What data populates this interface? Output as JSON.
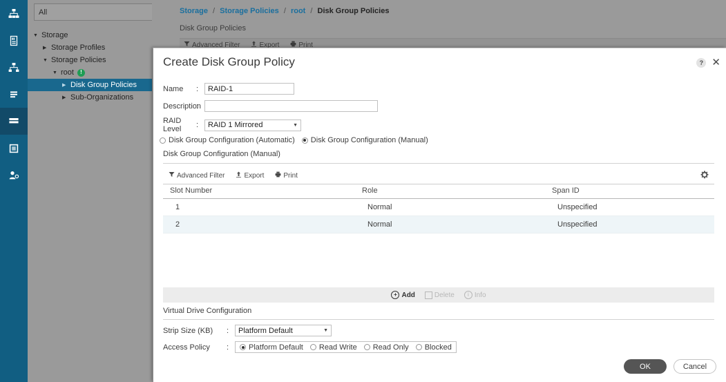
{
  "nav_rail": {
    "items": [
      {
        "name": "equipment-icon",
        "selected": false
      },
      {
        "name": "servers-icon",
        "selected": false
      },
      {
        "name": "lan-icon",
        "selected": false
      },
      {
        "name": "san-icon",
        "selected": false
      },
      {
        "name": "storage-icon",
        "selected": true
      },
      {
        "name": "chassis-icon",
        "selected": false
      },
      {
        "name": "admin-icon",
        "selected": false
      }
    ]
  },
  "sidebar": {
    "scope_value": "All",
    "tree": [
      {
        "label": "Storage",
        "level": 1,
        "twisty": "▼",
        "selected": false,
        "badge": false
      },
      {
        "label": "Storage Profiles",
        "level": 2,
        "twisty": "▶",
        "selected": false,
        "badge": false
      },
      {
        "label": "Storage Policies",
        "level": 2,
        "twisty": "▼",
        "selected": false,
        "badge": false
      },
      {
        "label": "root",
        "level": 3,
        "twisty": "▼",
        "selected": false,
        "badge": true
      },
      {
        "label": "Disk Group Policies",
        "level": 4,
        "twisty": "▶",
        "selected": true,
        "badge": false
      },
      {
        "label": "Sub-Organizations",
        "level": 4,
        "twisty": "▶",
        "selected": false,
        "badge": false
      }
    ]
  },
  "background": {
    "breadcrumb": {
      "items": [
        "Storage",
        "Storage Policies",
        "root"
      ],
      "current": "Disk Group Policies",
      "separator": "/"
    },
    "page_title": "Disk Group Policies",
    "toolbar": {
      "advanced_filter": "Advanced Filter",
      "export": "Export",
      "print": "Print"
    }
  },
  "dialog": {
    "title": "Create Disk Group Policy",
    "help_label": "?",
    "close_label": "✕",
    "fields": {
      "name_label": "Name",
      "name_value": "RAID-1",
      "description_label": "Description",
      "description_value": "",
      "raid_level_label": "RAID Level",
      "raid_level_value": "RAID 1 Mirrored",
      "colon": ":"
    },
    "config_mode": {
      "automatic_label": "Disk Group Configuration (Automatic)",
      "manual_label": "Disk Group Configuration (Manual)",
      "selected": "manual"
    },
    "manual_section_title": "Disk Group Configuration (Manual)",
    "table_toolbar": {
      "advanced_filter": "Advanced Filter",
      "export": "Export",
      "print": "Print",
      "settings_icon": "gear-icon"
    },
    "table": {
      "columns": [
        "Slot Number",
        "Role",
        "Span ID"
      ],
      "rows": [
        {
          "slot_number": "1",
          "role": "Normal",
          "span_id": "Unspecified",
          "selected": false
        },
        {
          "slot_number": "2",
          "role": "Normal",
          "span_id": "Unspecified",
          "selected": true
        }
      ]
    },
    "table_footer": {
      "add_label": "Add",
      "delete_label": "Delete",
      "info_label": "Info"
    },
    "virtual_drive": {
      "section_title": "Virtual Drive Configuration",
      "strip_size_label": "Strip Size (KB)",
      "strip_size_value": "Platform Default",
      "access_policy_label": "Access Policy",
      "access_policy_options": [
        {
          "label": "Platform Default",
          "selected": true
        },
        {
          "label": "Read Write",
          "selected": false
        },
        {
          "label": "Read Only",
          "selected": false
        },
        {
          "label": "Blocked",
          "selected": false
        }
      ],
      "colon": ":"
    },
    "footer": {
      "ok_label": "OK",
      "cancel_label": "Cancel"
    }
  },
  "colors": {
    "rail": "#115e82",
    "rail_selected": "#124a68",
    "tree_selected": "#19688e",
    "sidebar": "#9a9a9a",
    "breadcrumb_link": "#1a6f9e",
    "row_selected": "#eef5f8",
    "ok_button": "#555555"
  }
}
